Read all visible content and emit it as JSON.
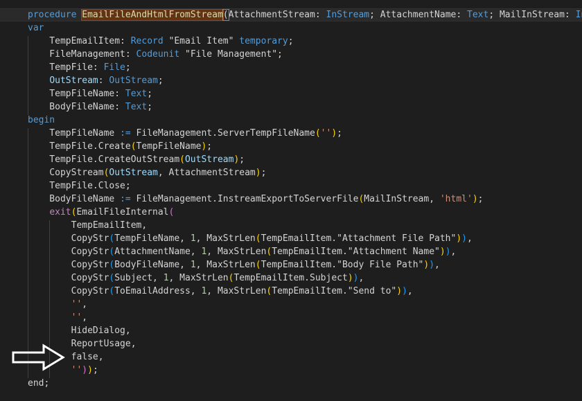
{
  "editor": {
    "lines": [
      [
        [
          "procedure ",
          "kw"
        ],
        [
          "EmailFileAndHtmlFromStream",
          "proc-name"
        ],
        [
          "(",
          "paren-match"
        ],
        [
          "AttachmentStream: ",
          "plain"
        ],
        [
          "InStream",
          "kw"
        ],
        [
          "; AttachmentName: ",
          "plain"
        ],
        [
          "Text",
          "kw"
        ],
        [
          "; MailInStream: ",
          "plain"
        ],
        [
          "InS",
          "kw"
        ]
      ],
      [
        [
          "var",
          "kw"
        ]
      ],
      [
        [
          "    TempEmailItem: ",
          "plain"
        ],
        [
          "Record",
          "kw"
        ],
        [
          " \"Email Item\" ",
          "plain"
        ],
        [
          "temporary",
          "kw"
        ],
        [
          ";",
          "plain"
        ]
      ],
      [
        [
          "    FileManagement: ",
          "plain"
        ],
        [
          "Codeunit",
          "kw"
        ],
        [
          " \"File Management\";",
          "plain"
        ]
      ],
      [
        [
          "    TempFile: ",
          "plain"
        ],
        [
          "File",
          "kw"
        ],
        [
          ";",
          "plain"
        ]
      ],
      [
        [
          "    ",
          "plain"
        ],
        [
          "OutStream",
          "vr"
        ],
        [
          ": ",
          "plain"
        ],
        [
          "OutStream",
          "kw"
        ],
        [
          ";",
          "plain"
        ]
      ],
      [
        [
          "    TempFileName: ",
          "plain"
        ],
        [
          "Text",
          "kw"
        ],
        [
          ";",
          "plain"
        ]
      ],
      [
        [
          "    BodyFileName: ",
          "plain"
        ],
        [
          "Text",
          "kw"
        ],
        [
          ";",
          "plain"
        ]
      ],
      [
        [
          "begin",
          "kw"
        ]
      ],
      [
        [
          "    TempFileName ",
          "plain"
        ],
        [
          ":=",
          "kw"
        ],
        [
          " FileManagement.ServerTempFileName",
          "plain"
        ],
        [
          "(",
          "y1"
        ],
        [
          "''",
          "str"
        ],
        [
          ")",
          "y1"
        ],
        [
          ";",
          "plain"
        ]
      ],
      [
        [
          "    TempFile.Create",
          "plain"
        ],
        [
          "(",
          "y1"
        ],
        [
          "TempFileName",
          "plain"
        ],
        [
          ")",
          "y1"
        ],
        [
          ";",
          "plain"
        ]
      ],
      [
        [
          "    TempFile.CreateOutStream",
          "plain"
        ],
        [
          "(",
          "y1"
        ],
        [
          "OutStream",
          "vr"
        ],
        [
          ")",
          "y1"
        ],
        [
          ";",
          "plain"
        ]
      ],
      [
        [
          "    CopyStream",
          "plain"
        ],
        [
          "(",
          "y1"
        ],
        [
          "OutStream",
          "vr"
        ],
        [
          ", AttachmentStream",
          "plain"
        ],
        [
          ")",
          "y1"
        ],
        [
          ";",
          "plain"
        ]
      ],
      [
        [
          "    TempFile.Close;",
          "plain"
        ]
      ],
      [
        [
          "    BodyFileName ",
          "plain"
        ],
        [
          ":=",
          "kw"
        ],
        [
          " FileManagement.InstreamExportToServerFile",
          "plain"
        ],
        [
          "(",
          "y1"
        ],
        [
          "MailInStream, ",
          "plain"
        ],
        [
          "'html'",
          "str"
        ],
        [
          ")",
          "y1"
        ],
        [
          ";",
          "plain"
        ]
      ],
      [
        [
          "    ",
          "plain"
        ],
        [
          "exit",
          "ctl"
        ],
        [
          "(",
          "y1"
        ],
        [
          "EmailFileInternal",
          "plain"
        ],
        [
          "(",
          "y2"
        ]
      ],
      [
        [
          "        TempEmailItem,",
          "plain"
        ]
      ],
      [
        [
          "        CopyStr",
          "plain"
        ],
        [
          "(",
          "y3"
        ],
        [
          "TempFileName, ",
          "plain"
        ],
        [
          "1",
          "num"
        ],
        [
          ", MaxStrLen",
          "plain"
        ],
        [
          "(",
          "y1"
        ],
        [
          "TempEmailItem.\"Attachment File Path\"",
          "plain"
        ],
        [
          ")",
          "y1"
        ],
        [
          ")",
          "y3"
        ],
        [
          ",",
          "plain"
        ]
      ],
      [
        [
          "        CopyStr",
          "plain"
        ],
        [
          "(",
          "y3"
        ],
        [
          "AttachmentName, ",
          "plain"
        ],
        [
          "1",
          "num"
        ],
        [
          ", MaxStrLen",
          "plain"
        ],
        [
          "(",
          "y1"
        ],
        [
          "TempEmailItem.\"Attachment Name\"",
          "plain"
        ],
        [
          ")",
          "y1"
        ],
        [
          ")",
          "y3"
        ],
        [
          ",",
          "plain"
        ]
      ],
      [
        [
          "        CopyStr",
          "plain"
        ],
        [
          "(",
          "y3"
        ],
        [
          "BodyFileName, ",
          "plain"
        ],
        [
          "1",
          "num"
        ],
        [
          ", MaxStrLen",
          "plain"
        ],
        [
          "(",
          "y1"
        ],
        [
          "TempEmailItem.\"Body File Path\"",
          "plain"
        ],
        [
          ")",
          "y1"
        ],
        [
          ")",
          "y3"
        ],
        [
          ",",
          "plain"
        ]
      ],
      [
        [
          "        CopyStr",
          "plain"
        ],
        [
          "(",
          "y3"
        ],
        [
          "Subject, ",
          "plain"
        ],
        [
          "1",
          "num"
        ],
        [
          ", MaxStrLen",
          "plain"
        ],
        [
          "(",
          "y1"
        ],
        [
          "TempEmailItem.Subject",
          "plain"
        ],
        [
          ")",
          "y1"
        ],
        [
          ")",
          "y3"
        ],
        [
          ",",
          "plain"
        ]
      ],
      [
        [
          "        CopyStr",
          "plain"
        ],
        [
          "(",
          "y3"
        ],
        [
          "ToEmailAddress, ",
          "plain"
        ],
        [
          "1",
          "num"
        ],
        [
          ", MaxStrLen",
          "plain"
        ],
        [
          "(",
          "y1"
        ],
        [
          "TempEmailItem.\"Send to\"",
          "plain"
        ],
        [
          ")",
          "y1"
        ],
        [
          ")",
          "y3"
        ],
        [
          ",",
          "plain"
        ]
      ],
      [
        [
          "        ''",
          "str"
        ],
        [
          ",",
          "plain"
        ]
      ],
      [
        [
          "        ''",
          "str"
        ],
        [
          ",",
          "plain"
        ]
      ],
      [
        [
          "        HideDialog,",
          "plain"
        ]
      ],
      [
        [
          "        ReportUsage,",
          "plain"
        ]
      ],
      [
        [
          "        false,",
          "plain"
        ]
      ],
      [
        [
          "        ",
          "plain"
        ],
        [
          "''",
          "str"
        ],
        [
          ")",
          "y2"
        ],
        [
          ")",
          "y1"
        ],
        [
          ";",
          "plain"
        ]
      ],
      [
        [
          "end;",
          "plain"
        ]
      ]
    ]
  },
  "annotation": {
    "arrow_icon": "right-arrow-outline-icon",
    "arrow_color": "#ffffff"
  }
}
